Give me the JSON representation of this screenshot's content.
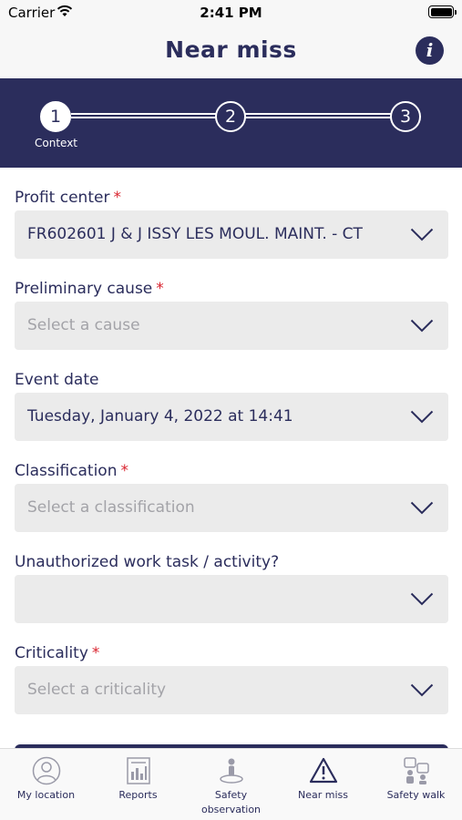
{
  "status_bar": {
    "carrier": "Carrier",
    "time": "2:41 PM"
  },
  "header": {
    "title": "Near miss",
    "info_icon": "info-icon"
  },
  "stepper": {
    "steps": [
      {
        "number": "1",
        "label": "Context",
        "active": true
      },
      {
        "number": "2",
        "label": "",
        "active": false
      },
      {
        "number": "3",
        "label": "",
        "active": false
      }
    ]
  },
  "form": {
    "fields": [
      {
        "label": "Profit center",
        "required": "*",
        "value": "FR602601 J & J ISSY LES MOUL. MAINT. - CT",
        "placeholder": ""
      },
      {
        "label": "Preliminary cause",
        "required": "*",
        "value": "",
        "placeholder": "Select a cause"
      },
      {
        "label": "Event date",
        "required": "",
        "value": "Tuesday, January 4, 2022 at 14:41",
        "placeholder": ""
      },
      {
        "label": "Classification",
        "required": "*",
        "value": "",
        "placeholder": "Select a classification"
      },
      {
        "label": "Unauthorized work task / activity?",
        "required": "",
        "value": "",
        "placeholder": ""
      },
      {
        "label": "Criticality",
        "required": "*",
        "value": "",
        "placeholder": "Select a criticality"
      }
    ]
  },
  "tab_bar": {
    "items": [
      {
        "label": "My location",
        "icon": "person-circle-icon"
      },
      {
        "label": "Reports",
        "icon": "bar-chart-icon"
      },
      {
        "label": "Safety observation",
        "icon": "observation-person-icon"
      },
      {
        "label": "Near miss",
        "icon": "warning-triangle-icon",
        "selected": true
      },
      {
        "label": "Safety walk",
        "icon": "safety-walk-icon"
      }
    ]
  },
  "colors": {
    "primary": "#2b2d5c",
    "required": "#d9232e",
    "field_bg": "#ebebeb",
    "placeholder": "#a3a3a8"
  }
}
